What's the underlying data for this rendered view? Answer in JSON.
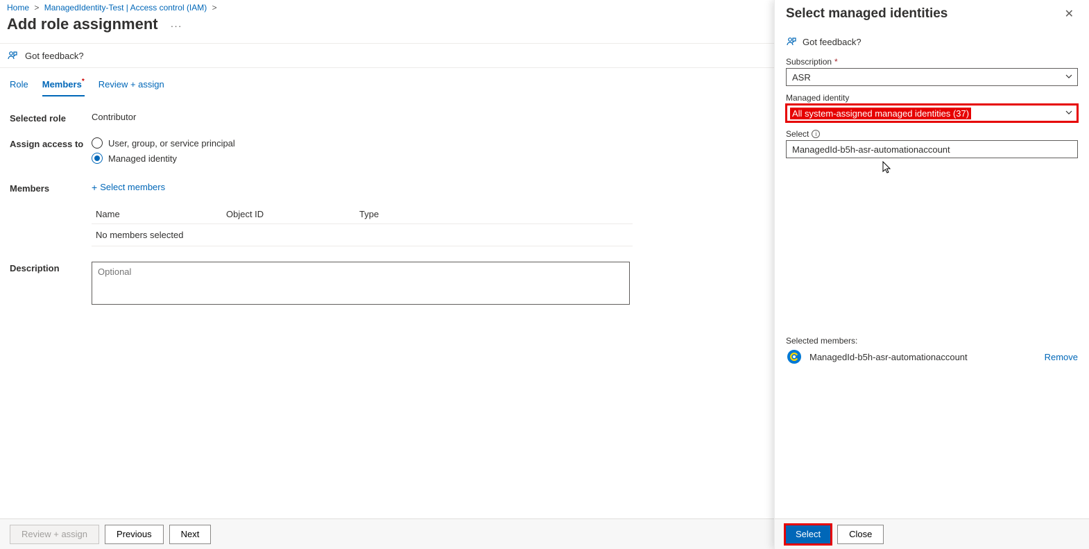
{
  "breadcrumb": {
    "home": "Home",
    "resource": "ManagedIdentity-Test | Access control (IAM)"
  },
  "page": {
    "title": "Add role assignment",
    "feedback": "Got feedback?"
  },
  "tabs": {
    "role": "Role",
    "members": "Members",
    "review": "Review + assign"
  },
  "form": {
    "selected_role_label": "Selected role",
    "selected_role_value": "Contributor",
    "assign_label": "Assign access to",
    "radio_user": "User, group, or service principal",
    "radio_mi": "Managed identity",
    "members_label": "Members",
    "select_members": "Select members",
    "table": {
      "name": "Name",
      "object_id": "Object ID",
      "type": "Type",
      "empty": "No members selected"
    },
    "description_label": "Description",
    "description_placeholder": "Optional"
  },
  "bottom": {
    "review": "Review + assign",
    "previous": "Previous",
    "next": "Next"
  },
  "panel": {
    "title": "Select managed identities",
    "feedback": "Got feedback?",
    "subscription_label": "Subscription",
    "subscription_value": "ASR",
    "mi_label": "Managed identity",
    "mi_value": "All system-assigned managed identities (37)",
    "select_label": "Select",
    "select_value": "ManagedId-b5h-asr-automationaccount",
    "selected_members_label": "Selected members:",
    "selected_member_name": "ManagedId-b5h-asr-automationaccount",
    "remove": "Remove",
    "select_btn": "Select",
    "close_btn": "Close"
  }
}
